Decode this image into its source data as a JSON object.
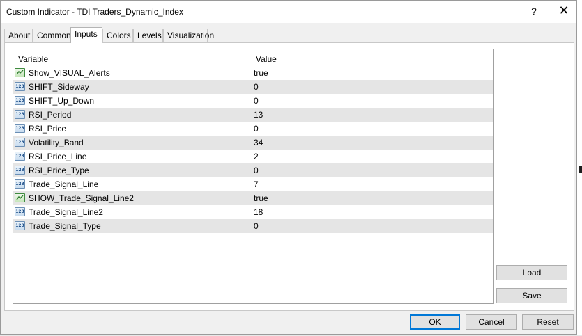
{
  "window": {
    "title": "Custom Indicator - TDI Traders_Dynamic_Index",
    "help_label": "?",
    "close_label": "✕"
  },
  "tabs": [
    {
      "label": "About"
    },
    {
      "label": "Common"
    },
    {
      "label": "Inputs"
    },
    {
      "label": "Colors"
    },
    {
      "label": "Levels"
    },
    {
      "label": "Visualization"
    }
  ],
  "active_tab": "Inputs",
  "table": {
    "headers": {
      "variable": "Variable",
      "value": "Value"
    },
    "rows": [
      {
        "type": "bool",
        "name": "Show_VISUAL_Alerts",
        "value": "true"
      },
      {
        "type": "int",
        "name": "SHIFT_Sideway",
        "value": "0"
      },
      {
        "type": "int",
        "name": "SHIFT_Up_Down",
        "value": "0"
      },
      {
        "type": "int",
        "name": "RSI_Period",
        "value": "13"
      },
      {
        "type": "int",
        "name": "RSI_Price",
        "value": "0"
      },
      {
        "type": "int",
        "name": "Volatility_Band",
        "value": "34"
      },
      {
        "type": "int",
        "name": "RSI_Price_Line",
        "value": "2"
      },
      {
        "type": "int",
        "name": "RSI_Price_Type",
        "value": "0"
      },
      {
        "type": "int",
        "name": "Trade_Signal_Line",
        "value": "7"
      },
      {
        "type": "bool",
        "name": "SHOW_Trade_Signal_Line2",
        "value": "true"
      },
      {
        "type": "int",
        "name": "Trade_Signal_Line2",
        "value": "18"
      },
      {
        "type": "int",
        "name": "Trade_Signal_Type",
        "value": "0"
      }
    ],
    "int_icon_text": "123"
  },
  "side_buttons": {
    "load": "Load",
    "save": "Save"
  },
  "footer_buttons": {
    "ok": "OK",
    "cancel": "Cancel",
    "reset": "Reset"
  },
  "colors": {
    "default_button_border": "#0078d7",
    "alt_row": "#e5e5e5"
  }
}
